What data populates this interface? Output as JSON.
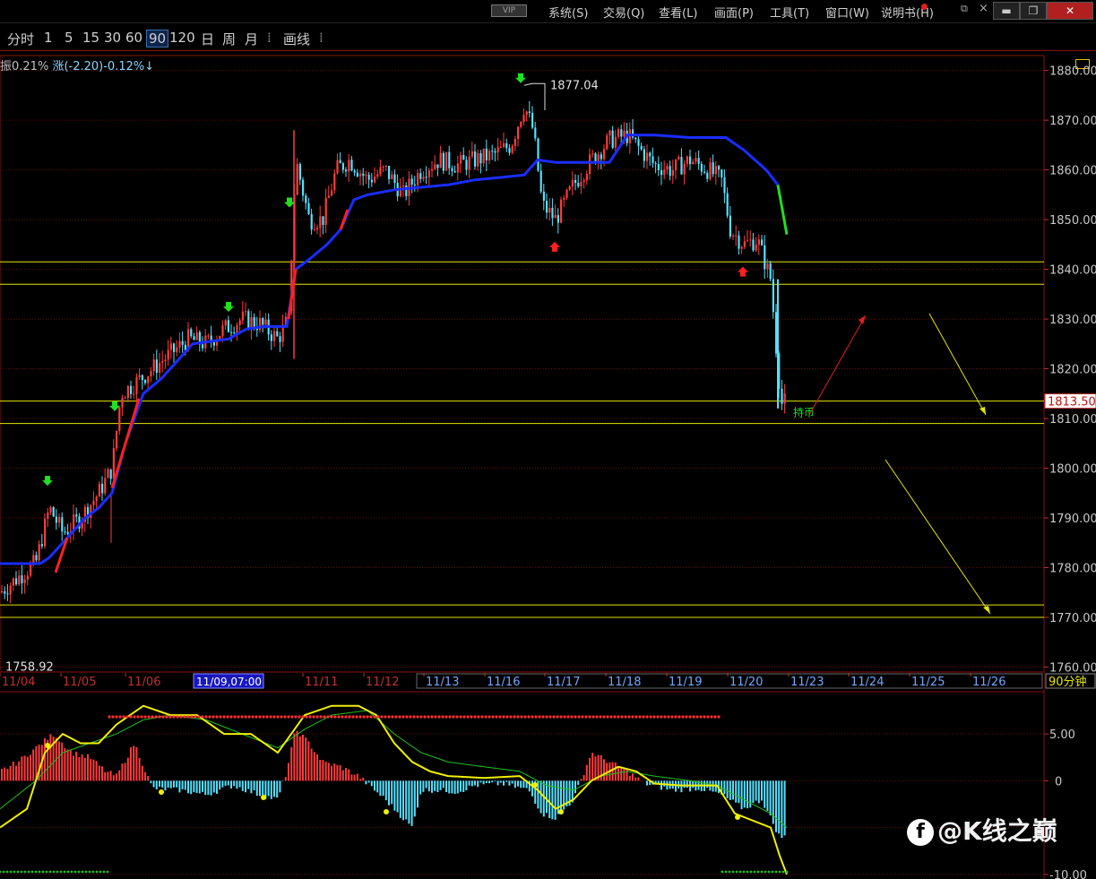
{
  "menubar": {
    "vip": "VIP",
    "items": [
      "系统(S)",
      "交易(Q)",
      "查看(L)",
      "画面(P)",
      "工具(T)",
      "窗口(W)",
      "说明书(H)"
    ]
  },
  "toolbar": {
    "items": [
      "分时",
      "1",
      "5",
      "15",
      "30",
      "60",
      "90",
      "120",
      "日",
      "周",
      "月"
    ],
    "active": "90",
    "draw": "画线"
  },
  "info": {
    "amplitude": "振0.21%",
    "change": "涨(-2.20)-0.12%↓"
  },
  "colors": {
    "candle_up": "#ff3b3b",
    "candle_down": "#54e1ff",
    "ma_blue": "#1a2dff",
    "ma_red": "#ff2020",
    "ma_green": "#20e020",
    "grid": "#6a1010",
    "level_line": "#e6e600",
    "label_yellow": "#e6e600"
  },
  "chart_data": [
    {
      "type": "candlestick",
      "y_ticks": [
        "1880.00",
        "1870.00",
        "1860.00",
        "1850.00",
        "1840.00",
        "1830.00",
        "1820.00",
        "1810.00",
        "1800.00",
        "1790.00",
        "1780.00",
        "1770.00",
        "1760.00"
      ],
      "ylim": [
        1759,
        1883
      ],
      "x_labels": [
        "11/04",
        "11/05",
        "11/06",
        "11/11",
        "11/12",
        "11/13",
        "11/16",
        "11/17",
        "11/18",
        "11/19",
        "11/20",
        "11/23",
        "11/24",
        "11/25",
        "11/26"
      ],
      "crosshair_label": "11/09,07:00",
      "period_label": "90分钟",
      "current_price_label": "1813.50",
      "high_label": "1877.04",
      "low_label": "1758.92",
      "annotation": "持币",
      "horizontal_levels": [
        1841.5,
        1837.0,
        1813.5,
        1809.0,
        1772.5,
        1770.0
      ],
      "approx_close_path": [
        [
          0,
          1775
        ],
        [
          20,
          1778
        ],
        [
          40,
          1781
        ],
        [
          55,
          1792
        ],
        [
          70,
          1787
        ],
        [
          90,
          1790
        ],
        [
          110,
          1795
        ],
        [
          125,
          1800
        ],
        [
          135,
          1815
        ],
        [
          150,
          1817
        ],
        [
          170,
          1820
        ],
        [
          190,
          1823
        ],
        [
          210,
          1826
        ],
        [
          230,
          1825
        ],
        [
          250,
          1828
        ],
        [
          270,
          1830
        ],
        [
          290,
          1829
        ],
        [
          310,
          1826
        ],
        [
          322,
          1830
        ],
        [
          330,
          1862
        ],
        [
          345,
          1850
        ],
        [
          360,
          1850
        ],
        [
          375,
          1860
        ],
        [
          390,
          1862
        ],
        [
          410,
          1858
        ],
        [
          430,
          1860
        ],
        [
          450,
          1855
        ],
        [
          470,
          1860
        ],
        [
          490,
          1862
        ],
        [
          510,
          1861
        ],
        [
          530,
          1862
        ],
        [
          550,
          1863
        ],
        [
          570,
          1865
        ],
        [
          585,
          1873
        ],
        [
          595,
          1868
        ],
        [
          605,
          1853
        ],
        [
          620,
          1850
        ],
        [
          640,
          1857
        ],
        [
          660,
          1862
        ],
        [
          680,
          1866
        ],
        [
          700,
          1867
        ],
        [
          715,
          1864
        ],
        [
          730,
          1861
        ],
        [
          750,
          1860
        ],
        [
          770,
          1862
        ],
        [
          790,
          1860
        ],
        [
          805,
          1858
        ],
        [
          815,
          1848
        ],
        [
          830,
          1845
        ],
        [
          845,
          1846
        ],
        [
          860,
          1838
        ],
        [
          868,
          1820
        ],
        [
          872,
          1813
        ],
        [
          878,
          1813.5
        ]
      ]
    },
    {
      "type": "line",
      "y_ticks": [
        "5.00",
        "0",
        "-10.00"
      ],
      "ylim": [
        -10.2,
        9.5
      ]
    }
  ]
}
